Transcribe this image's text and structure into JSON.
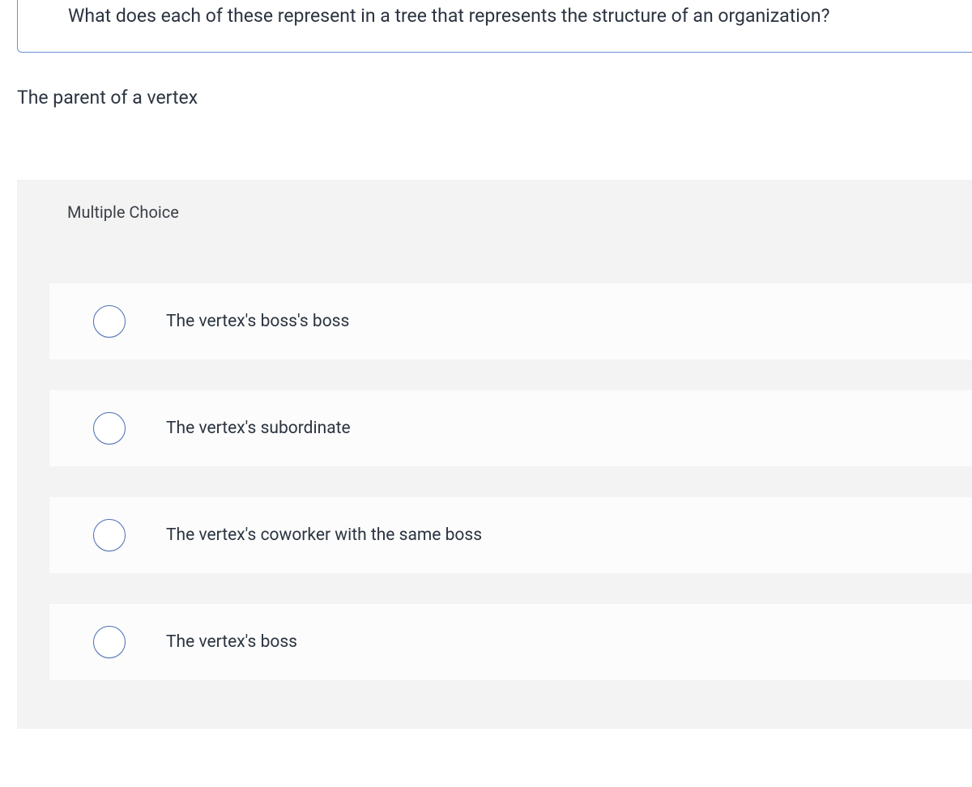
{
  "question": {
    "prompt_line": "What does each of these represent in a tree that represents the structure of an organization?",
    "sub_prompt": "The parent of a vertex"
  },
  "multiple_choice": {
    "header": "Multiple Choice",
    "options": [
      {
        "label": "The vertex's boss's boss"
      },
      {
        "label": "The vertex's subordinate"
      },
      {
        "label": "The vertex's coworker with the same boss"
      },
      {
        "label": "The vertex's boss"
      }
    ]
  }
}
